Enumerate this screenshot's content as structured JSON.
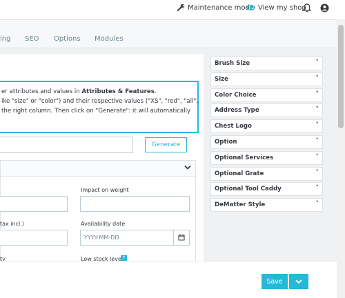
{
  "topbar": {
    "maintenance_label": "Maintenance mode",
    "view_shop_label": "View my shop"
  },
  "tabs": [
    {
      "label": "ing"
    },
    {
      "label": "SEO"
    },
    {
      "label": "Options"
    },
    {
      "label": "Modules"
    }
  ],
  "info": {
    "line1_prefix": "er attributes and values in ",
    "line1_bold": "Attributes & Features",
    "line1_suffix": ".",
    "line2": "ike \"size\" or \"color\") and their respective values (\"XS\", \"red\", \"all\",",
    "line3": "the right column. Then click on \"Generate\": it will automatically"
  },
  "generate_label": "Generate",
  "form": {
    "impact_weight_label": "Impact on weight",
    "tax_label": "tax incl.)",
    "availability_label": "Availability date",
    "date_placeholder": "YYYY-MM-DD",
    "ty_label": "ty",
    "low_stock_label": "Low stock level"
  },
  "attributes": [
    {
      "label": "Brush Size"
    },
    {
      "label": "Size"
    },
    {
      "label": "Color Choice"
    },
    {
      "label": "Address Type"
    },
    {
      "label": "Chest Logo"
    },
    {
      "label": "Option"
    },
    {
      "label": "Optional Services"
    },
    {
      "label": "Optional Grate"
    },
    {
      "label": "Optional Tool Caddy"
    },
    {
      "label": "DeMatter Style"
    }
  ],
  "footer": {
    "save_label": "Save"
  },
  "colors": {
    "accent": "#25b9d7"
  }
}
